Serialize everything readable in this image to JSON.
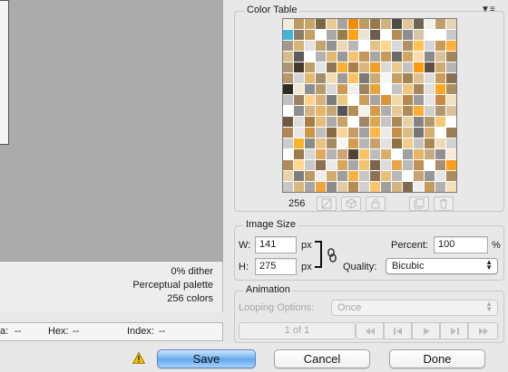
{
  "preview_info": {
    "dither": "0% dither",
    "palette": "Perceptual palette",
    "colors": "256 colors"
  },
  "status_bar": {
    "alpha_label": "a:",
    "alpha_value": "--",
    "hex_label": "Hex:",
    "hex_value": "--",
    "index_label": "Index:",
    "index_value": "--"
  },
  "color_table": {
    "title": "Color Table",
    "count": "256",
    "swatch_colors": [
      "#f3ead7",
      "#bb9b5e",
      "#c8a667",
      "#7b6845",
      "#e7cc94",
      "#a4a4a4",
      "#f08c00",
      "#bf9a63",
      "#997a4a",
      "#d0b27f",
      "#4b4b4b",
      "#e0c697",
      "#726452",
      "#f4f1e9",
      "#c19f6b",
      "#e6d5b5",
      "#3fb6d8",
      "#8c7d6a",
      "#c69f61",
      "#ffffff",
      "#a9a9a9",
      "#9a7c4a",
      "#ffa017",
      "#e9e3d8",
      "#6b5d48",
      "#ffffff",
      "#b38e53",
      "#8d8d8d",
      "#d7c6a6",
      "#ffffff",
      "#ffffff",
      "#c9c9c9",
      "#a39889",
      "#d8b376",
      "#e2e2e2",
      "#c5a36c",
      "#939393",
      "#ecd7b0",
      "#b7b7b7",
      "#ffffff",
      "#e3c488",
      "#fed48f",
      "#d9d9d9",
      "#af9264",
      "#ffc253",
      "#d5d5d5",
      "#c69d5c",
      "#ffb13a",
      "#d7bd8c",
      "#5c5c5c",
      "#ffffff",
      "#b2b2b2",
      "#e1b970",
      "#999999",
      "#f5c372",
      "#c49657",
      "#a7a7a7",
      "#c59b58",
      "#6b6b6b",
      "#d1a665",
      "#f8deae",
      "#8a8a8a",
      "#d9c09a",
      "#a28456",
      "#ad9875",
      "#443a2c",
      "#bfa06a",
      "#e3e3e3",
      "#8f7758",
      "#f9b02e",
      "#a8814a",
      "#d9b880",
      "#f29f24",
      "#dadada",
      "#e9c98d",
      "#c2c2c2",
      "#fb9b10",
      "#5e503c",
      "#cdab73",
      "#b5b5b5",
      "#b7976c",
      "#d4d4d4",
      "#e2b872",
      "#a38e70",
      "#f3dcae",
      "#9b9b9b",
      "#ffc35e",
      "#7a7a7a",
      "#cbaa76",
      "#f6f6f6",
      "#c4a061",
      "#a48454",
      "#dfc190",
      "#dddddd",
      "#c89d5e",
      "#8a7050",
      "#2f2a22",
      "#f1e7d2",
      "#8e8e8e",
      "#b99b6b",
      "#d8d8d8",
      "#ce9a52",
      "#eef0f0",
      "#9b855e",
      "#e8a33b",
      "#ffffff",
      "#c4c4c4",
      "#efc67c",
      "#a4855c",
      "#e0e0e0",
      "#fda623",
      "#ad8e60",
      "#c0c0c0",
      "#9a8263",
      "#ffd18a",
      "#d9b17a",
      "#7d7d7d",
      "#ebc882",
      "#ffffff",
      "#ca9e5e",
      "#a5a5a5",
      "#e19235",
      "#f0d9a8",
      "#b28a4d",
      "#9c9c9c",
      "#e5e5e5",
      "#c68a43",
      "#f4e3c2",
      "#ffffff",
      "#8f8f8f",
      "#d2b487",
      "#e5b76b",
      "#c8a673",
      "#555555",
      "#b58d55",
      "#f0f0f0",
      "#d99b48",
      "#afafaf",
      "#e8c994",
      "#ae8d5d",
      "#ffad33",
      "#cfcfcf",
      "#b3976f",
      "#dcc29a",
      "#6e5b3f",
      "#dddddd",
      "#a77f45",
      "#e6be7a",
      "#aaaaaa",
      "#c9a265",
      "#ffffff",
      "#9e8662",
      "#dfa650",
      "#c5c5c5",
      "#a9895a",
      "#e6d1a8",
      "#858585",
      "#b49769",
      "#f7c777",
      "#ffffff",
      "#b18754",
      "#e7e7e7",
      "#ce9543",
      "#bfbfbf",
      "#8b6b42",
      "#f5d59b",
      "#c59c63",
      "#a2a2a2",
      "#ffb74a",
      "#ebebeb",
      "#c48f48",
      "#dcbb85",
      "#767676",
      "#d7ae6d",
      "#ffffff",
      "#9c7e55",
      "#cccccc",
      "#fab12b",
      "#8b8b8b",
      "#e5c184",
      "#a68a60",
      "#f6f6f6",
      "#d49c4f",
      "#b6b6b6",
      "#c8a06a",
      "#e1e1e1",
      "#8f6f44",
      "#f0cd8c",
      "#c3c3c3",
      "#ad8753",
      "#eedbb6",
      "#d3d3d3",
      "#ffffff",
      "#9f7b4b",
      "#d6d6d6",
      "#e3a95a",
      "#b4b4b4",
      "#cea574",
      "#4f4336",
      "#fbc261",
      "#bdbdbd",
      "#d9ad6b",
      "#ffffff",
      "#a0a0a0",
      "#e8b566",
      "#c7aa82",
      "#919191",
      "#f7ebd3",
      "#b08a5a",
      "#fdd68f",
      "#c9c9c9",
      "#8e7050",
      "#eaeaea",
      "#d8a55d",
      "#a8a8a8",
      "#f2c172",
      "#7c6448",
      "#dcdcdc",
      "#e5a747",
      "#bababa",
      "#c09156",
      "#ffffff",
      "#a78f6e",
      "#ff9e1a",
      "#e9d3ab",
      "#7f7f7f",
      "#bc9862",
      "#ededed",
      "#d4aa6b",
      "#9d9d9d",
      "#f6b242",
      "#c6c6c6",
      "#8d7352",
      "#e8c07c",
      "#b9b9b9",
      "#ffffff",
      "#caa270",
      "#969696",
      "#e6e6e6",
      "#ad8c5c",
      "#c7c7c7",
      "#dbb77a",
      "#a6a6a6",
      "#f0a53a",
      "#8c8c8c",
      "#e2cba5",
      "#b68b4f",
      "#d1d1d1",
      "#fcc56c",
      "#9f9f9f",
      "#d5b282",
      "#7e6a4e",
      "#eeeeee",
      "#c49a5a",
      "#b1b1b1",
      "#f3e0b9"
    ]
  },
  "image_size": {
    "title": "Image Size",
    "width_label": "W:",
    "width_value": "141",
    "height_label": "H:",
    "height_value": "275",
    "unit": "px",
    "percent_label": "Percent:",
    "percent_value": "100",
    "percent_unit": "%",
    "quality_label": "Quality:",
    "quality_value": "Bicubic"
  },
  "animation": {
    "title": "Animation",
    "looping_label": "Looping Options:",
    "looping_value": "Once",
    "frame_counter": "1 of 1"
  },
  "buttons": {
    "save": "Save",
    "cancel": "Cancel",
    "done": "Done"
  },
  "colors": {
    "accent": "#6fb2f2",
    "warning": "#f2c200"
  }
}
